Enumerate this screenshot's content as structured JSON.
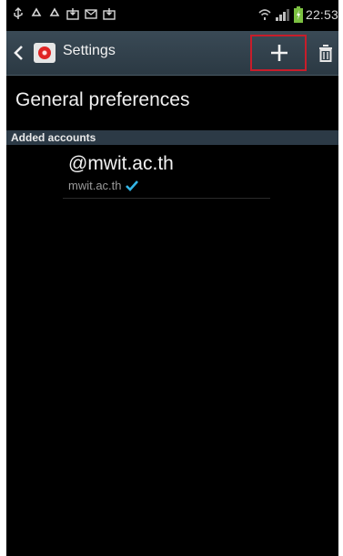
{
  "status_bar": {
    "time": "22:53",
    "left_icons": [
      "usb-icon",
      "recycle-icon",
      "recycle-icon",
      "download-icon",
      "mail-icon",
      "download-icon"
    ],
    "right_icons": [
      "wifi-icon",
      "signal-icon",
      "battery-icon"
    ]
  },
  "action_bar": {
    "title": "Settings",
    "back_icon": "back-chevron-icon",
    "app_icon": "email-app-icon",
    "add_icon": "plus-icon",
    "delete_icon": "trash-icon",
    "highlight_color": "#c81d2a"
  },
  "content": {
    "general_preferences": "General preferences",
    "section_header": "Added accounts",
    "accounts": [
      {
        "name": "@mwit.ac.th",
        "address": "mwit.ac.th",
        "status_icon": "checkmark-icon"
      }
    ]
  },
  "colors": {
    "background": "#000000",
    "action_bar": "#2f3e49",
    "section_header": "#2c3a46",
    "checkmark": "#33b5e5"
  }
}
